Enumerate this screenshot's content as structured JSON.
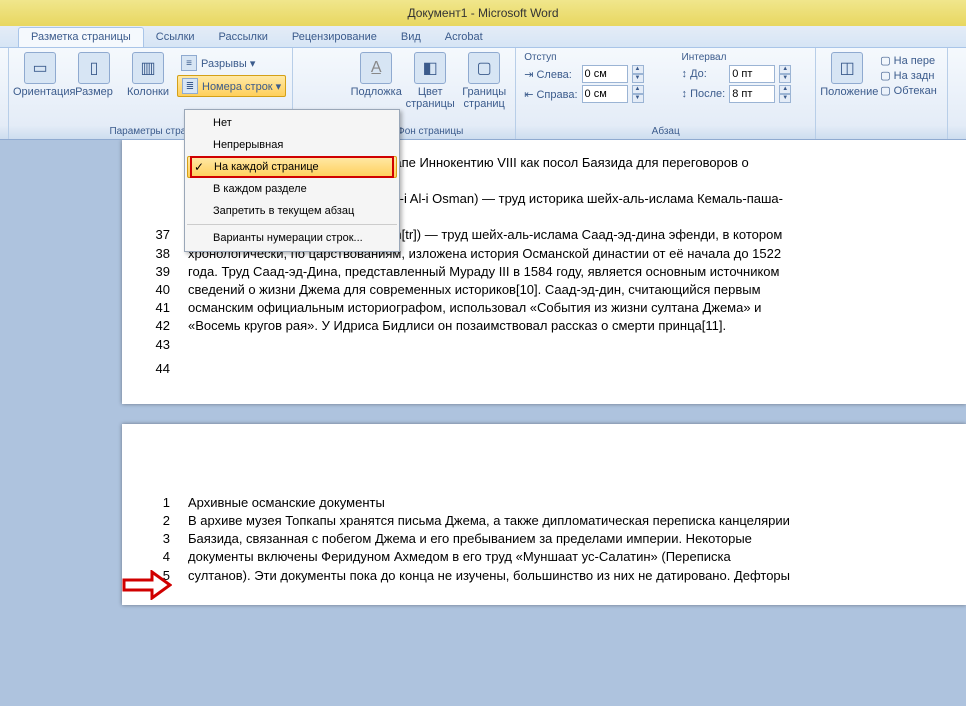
{
  "title": "Документ1 - Microsoft Word",
  "tabs": [
    "Разметка страницы",
    "Ссылки",
    "Рассылки",
    "Рецензирование",
    "Вид",
    "Acrobat"
  ],
  "active_tab": 0,
  "groups": {
    "page_setup": {
      "label": "Параметры стран",
      "orient": "Ориентация",
      "size": "Размер",
      "cols": "Колонки",
      "breaks": "Разрывы ▾",
      "line_nums": "Номера строк ▾"
    },
    "page_bg": {
      "label": "Фон страницы",
      "watermark": "Подложка",
      "color": "Цвет страницы",
      "borders": "Границы страниц"
    },
    "paragraph": {
      "label": "Абзац",
      "indent_title": "Отступ",
      "left": "Слева:",
      "right": "Справа:",
      "left_val": "0 см",
      "right_val": "0 см",
      "spacing_title": "Интервал",
      "before": "До:",
      "after": "После:",
      "before_val": "0 пт",
      "after_val": "8 пт"
    },
    "arrange": {
      "position": "Положение",
      "front": "На пере",
      "back": "На задн",
      "wrap": "Обтекан"
    }
  },
  "dropdown": {
    "items": [
      {
        "label": "Нет",
        "underline": 0
      },
      {
        "label": "Непрерывная",
        "underline": 0
      },
      {
        "label": "На каждой странице",
        "underline": 3,
        "selected": true,
        "boxed": true
      },
      {
        "label": "В каждом разделе",
        "underline": 0
      },
      {
        "label": "Запретить в текущем абзац",
        "underline": 0
      }
    ],
    "last": "Варианты нумерации строк..."
  },
  "doc": {
    "page1": {
      "tail": "к папе Иннокентию VIII как посол Баязида для переговоров о",
      "mid": "arih-i Al-i Osman) — труд историка шейх-аль-ислама Кемаль-паша-",
      "lines": [
        {
          "n": 37,
          "t": "«Корона летописей» (Tâcü't-Tevârih[tr]) — труд шейх-аль-ислама Саад-эд-дина эфенди, в котором"
        },
        {
          "n": 38,
          "t": "хронологически, по царствованиям, изложена история Османской династии от её начала до 1522"
        },
        {
          "n": 39,
          "t": "года. Труд Саад-эд-Дина, представленный Мураду III в 1584 году, является основным источником"
        },
        {
          "n": 40,
          "t": "сведений о жизни Джема для современных историков[10]. Саад-эд-дин, считающийся первым"
        },
        {
          "n": 41,
          "t": "османским официальным историографом, использовал «События из жизни султана Джема» и"
        },
        {
          "n": 42,
          "t": "«Восемь кругов рая». У Идриса Бидлиси он позаимствовал рассказ о смерти принца[11]."
        },
        {
          "n": 43,
          "t": ""
        },
        {
          "n": 44,
          "t": ""
        }
      ]
    },
    "page2": {
      "lines": [
        {
          "n": 1,
          "t": "Архивные османские документы"
        },
        {
          "n": "",
          "t": ""
        },
        {
          "n": 2,
          "t": "В архиве музея Топкапы хранятся письма Джема, а также дипломатическая переписка канцелярии"
        },
        {
          "n": 3,
          "t": "Баязида, связанная с побегом Джема и его пребыванием за пределами империи. Некоторые"
        },
        {
          "n": 4,
          "t": "документы включены Феридуном Ахмедом в его труд «Муншаат ус-Салатин» (Переписка"
        },
        {
          "n": 5,
          "t": "султанов). Эти документы пока до конца не изучены, большинство из них не датировано. Дефторы"
        }
      ]
    }
  }
}
